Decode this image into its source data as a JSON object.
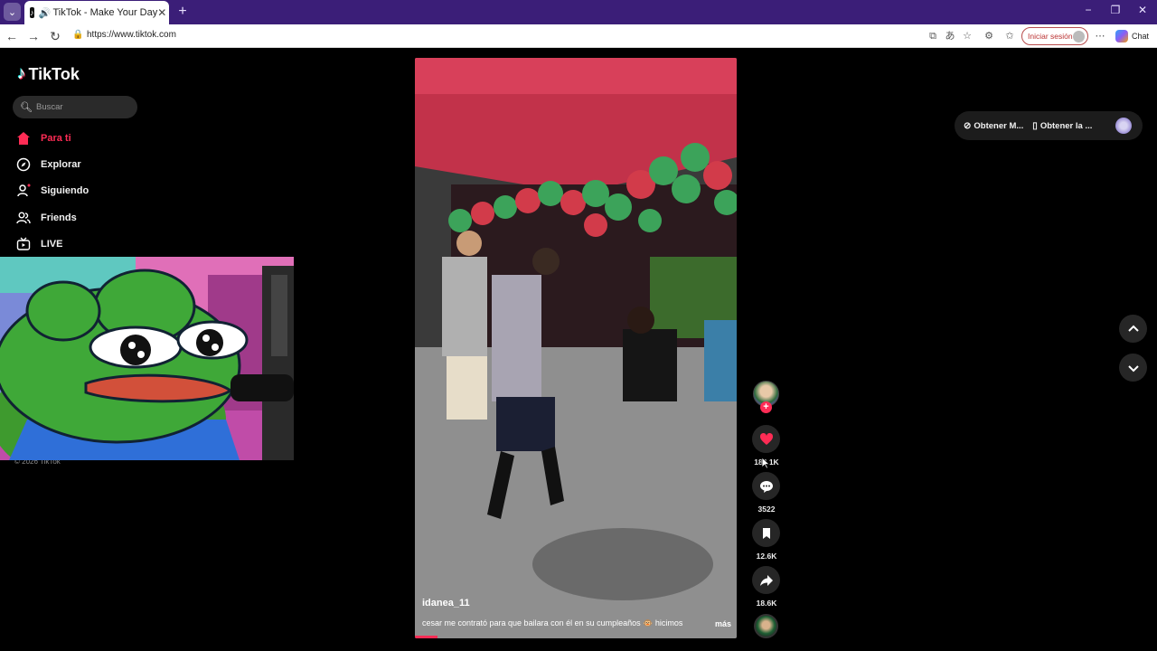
{
  "browser": {
    "tab_title": "TikTok - Make Your Day",
    "url": "https://www.tiktok.com",
    "signin_label": "Iniciar sesión",
    "chat_label": "Chat",
    "minimize": "−",
    "maximize": "❐",
    "close": "✕"
  },
  "sidebar": {
    "logo_text": "TikTok",
    "search_placeholder": "Buscar",
    "items": [
      {
        "label": "Para ti",
        "icon": "home-icon",
        "active": true
      },
      {
        "label": "Explorar",
        "icon": "compass-icon"
      },
      {
        "label": "Siguiendo",
        "icon": "following-icon"
      },
      {
        "label": "Friends",
        "icon": "friends-icon"
      },
      {
        "label": "LIVE",
        "icon": "live-icon"
      }
    ],
    "copyright": "© 2026 TikTok"
  },
  "header": {
    "get_coins_label": "Obtener M...",
    "get_app_label": "Obtener la ..."
  },
  "video": {
    "author": "idanea_11",
    "caption": "cesar me contrató para que bailara con él en su cumpleaños 🐵 hicimos",
    "more_label": "más",
    "progress": 0.07
  },
  "actions": {
    "likes": "186.1K",
    "comments": "3522",
    "saves": "12.6K",
    "shares": "18.6K"
  },
  "colors": {
    "accent": "#fe2c55",
    "browser_frame": "#3b1e78"
  }
}
